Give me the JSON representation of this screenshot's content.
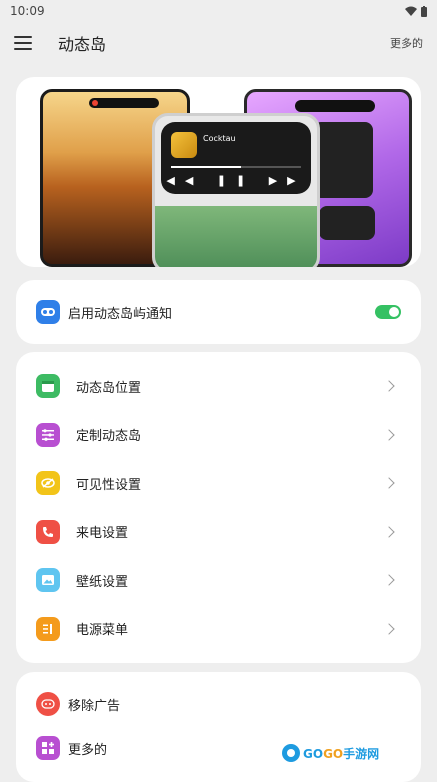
{
  "status": {
    "time": "10:09"
  },
  "header": {
    "title": "动态岛",
    "more": "更多的"
  },
  "banner": {
    "song": "Cocktau",
    "artist": ""
  },
  "toggle": {
    "label": "启用动态岛屿通知",
    "enabled": true,
    "color": "#35c163"
  },
  "menu": [
    {
      "label": "动态岛位置",
      "icon": "calendar-icon",
      "color": "#3dbb63"
    },
    {
      "label": "定制动态岛",
      "icon": "sliders-icon",
      "color": "#b84fd1"
    },
    {
      "label": "可见性设置",
      "icon": "eye-off-icon",
      "color": "#f2c419"
    },
    {
      "label": "来电设置",
      "icon": "phone-icon",
      "color": "#ef5045"
    },
    {
      "label": "壁纸设置",
      "icon": "image-icon",
      "color": "#5fc5f0"
    },
    {
      "label": "电源菜单",
      "icon": "power-menu-icon",
      "color": "#f49b1c"
    }
  ],
  "bottom": [
    {
      "label": "移除广告",
      "icon": "remove-ads-icon",
      "color": "#ef5045"
    },
    {
      "label": "更多的",
      "icon": "grid-plus-icon",
      "color": "#b84fd1"
    }
  ],
  "watermark": {
    "text1": "GO",
    "text2": "GO",
    "text3": "手游网"
  }
}
